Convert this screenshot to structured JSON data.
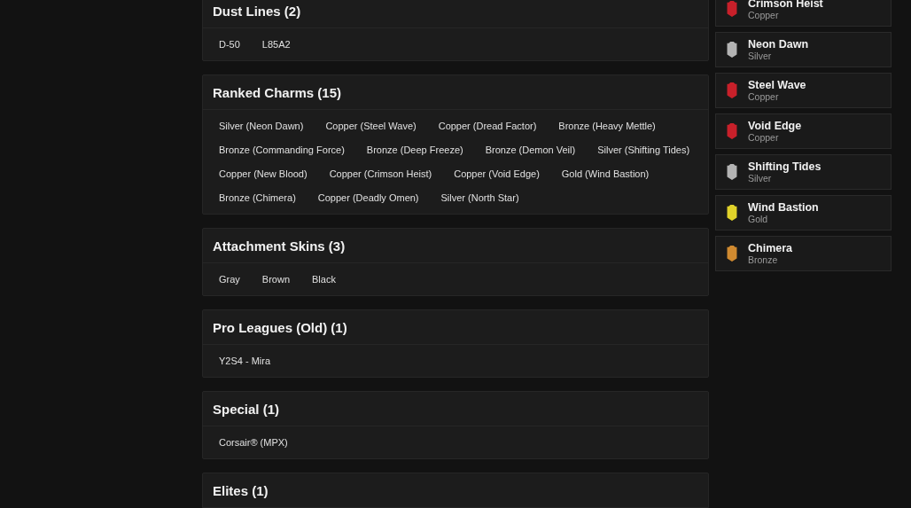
{
  "sections": [
    {
      "title": "Dust Lines (2)",
      "items": [
        "D-50",
        "L85A2"
      ]
    },
    {
      "title": "Ranked Charms (15)",
      "items": [
        "Silver (Neon Dawn)",
        "Copper (Steel Wave)",
        "Copper (Dread Factor)",
        "Bronze (Heavy Mettle)",
        "Bronze (Commanding Force)",
        "Bronze (Deep Freeze)",
        "Bronze (Demon Veil)",
        "Silver (Shifting Tides)",
        "Copper (New Blood)",
        "Copper (Crimson Heist)",
        "Copper (Void Edge)",
        "Gold (Wind Bastion)",
        "Bronze (Chimera)",
        "Copper (Deadly Omen)",
        "Silver (North Star)"
      ]
    },
    {
      "title": "Attachment Skins (3)",
      "items": [
        "Gray",
        "Brown",
        "Black"
      ]
    },
    {
      "title": "Pro Leagues (Old) (1)",
      "items": [
        "Y2S4 - Mira"
      ]
    },
    {
      "title": "Special (1)",
      "items": [
        "Corsair® (MPX)"
      ]
    },
    {
      "title": "Elites (1)"
    }
  ],
  "charms": [
    {
      "name": "Crimson Heist",
      "tier": "Copper",
      "color": "#c8202a"
    },
    {
      "name": "Neon Dawn",
      "tier": "Silver",
      "color": "#b4b4b4"
    },
    {
      "name": "Steel Wave",
      "tier": "Copper",
      "color": "#c8202a"
    },
    {
      "name": "Void Edge",
      "tier": "Copper",
      "color": "#c8202a"
    },
    {
      "name": "Shifting Tides",
      "tier": "Silver",
      "color": "#b4b4b4"
    },
    {
      "name": "Wind Bastion",
      "tier": "Gold",
      "color": "#e0d22a"
    },
    {
      "name": "Chimera",
      "tier": "Bronze",
      "color": "#d08a30"
    }
  ]
}
